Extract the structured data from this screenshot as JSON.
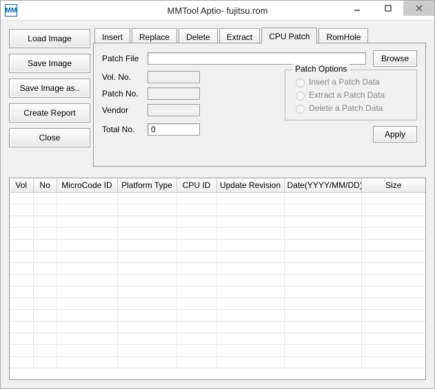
{
  "window": {
    "title": "MMTool Aptio- fujitsu.rom",
    "icon_label": "MM"
  },
  "sidebar": {
    "load_image": "Load Image",
    "save_image": "Save Image",
    "save_image_as": "Save Image as..",
    "create_report": "Create Report",
    "close": "Close"
  },
  "tabs": {
    "insert": "Insert",
    "replace": "Replace",
    "delete": "Delete",
    "extract": "Extract",
    "cpu_patch": "CPU Patch",
    "rom_hole": "RomHole",
    "selected": "cpu_patch"
  },
  "form": {
    "patch_file_label": "Patch File",
    "patch_file_value": "",
    "browse": "Browse",
    "vol_no_label": "Vol. No.",
    "vol_no_value": "",
    "patch_no_label": "Patch No.",
    "patch_no_value": "",
    "vendor_label": "Vendor",
    "vendor_value": "",
    "total_no_label": "Total No.",
    "total_no_value": "0"
  },
  "patch_options": {
    "legend": "Patch Options",
    "insert": "Insert a Patch Data",
    "extract": "Extract a Patch Data",
    "delete": "Delete a Patch Data",
    "apply": "Apply"
  },
  "table": {
    "headers": {
      "vol": "Vol",
      "no": "No",
      "microcode_id": "MicroCode ID",
      "platform_type": "Platform Type",
      "cpu_id": "CPU ID",
      "update_revision": "Update Revision",
      "date": "Date(YYYY/MM/DD)",
      "size": "Size"
    },
    "rows": []
  }
}
